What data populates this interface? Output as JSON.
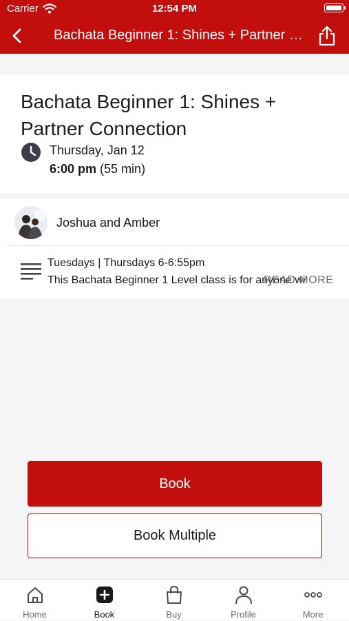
{
  "status_bar": {
    "carrier": "Carrier",
    "time": "12:54 PM"
  },
  "nav": {
    "title": "Bachata Beginner 1: Shines + Partner Connection"
  },
  "class": {
    "title": "Bachata Beginner 1: Shines + Partner Connection",
    "date": "Thursday, Jan 12",
    "time": "6:00 pm",
    "duration": "(55 min)"
  },
  "teacher": {
    "name": "Joshua and Amber"
  },
  "description": {
    "schedule": "Tuesdays | Thursdays 6-6:55pm",
    "text": "This Bachata Beginner 1 Level class is for anyone wi",
    "read_more": "READ MORE"
  },
  "actions": {
    "book": "Book",
    "book_multiple": "Book Multiple"
  },
  "tabbar": {
    "items": [
      {
        "label": "Home",
        "icon": "home-icon"
      },
      {
        "label": "Book",
        "icon": "plus-square-icon"
      },
      {
        "label": "Buy",
        "icon": "bag-icon"
      },
      {
        "label": "Profile",
        "icon": "person-icon"
      },
      {
        "label": "More",
        "icon": "ellipsis-icon"
      }
    ],
    "active": "Book"
  },
  "colors": {
    "brand": "#c30e0e",
    "background": "#f5f5f7"
  }
}
